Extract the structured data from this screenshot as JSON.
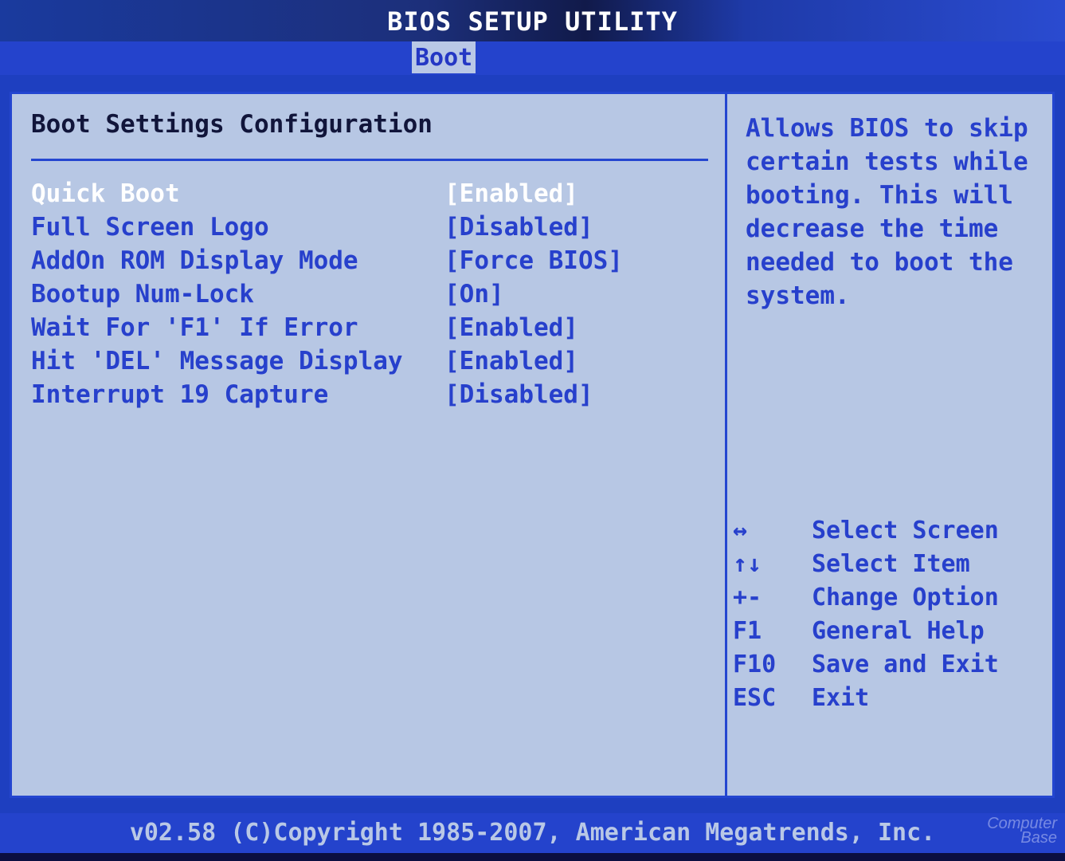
{
  "window": {
    "title": "BIOS SETUP UTILITY"
  },
  "menu": {
    "tabs": [
      {
        "label": "Boot",
        "active": true
      }
    ]
  },
  "main": {
    "section_title": "Boot Settings Configuration",
    "settings": [
      {
        "label": "Quick Boot",
        "value": "[Enabled]",
        "selected": true
      },
      {
        "label": "Full Screen Logo",
        "value": "[Disabled]",
        "selected": false
      },
      {
        "label": "AddOn ROM Display Mode",
        "value": "[Force BIOS]",
        "selected": false
      },
      {
        "label": "Bootup Num-Lock",
        "value": "[On]",
        "selected": false
      },
      {
        "label": "Wait For 'F1' If Error",
        "value": "[Enabled]",
        "selected": false
      },
      {
        "label": "Hit 'DEL' Message Display",
        "value": "[Enabled]",
        "selected": false
      },
      {
        "label": "Interrupt 19 Capture",
        "value": "[Disabled]",
        "selected": false
      }
    ]
  },
  "help": {
    "lines": [
      "Allows BIOS to skip",
      "certain tests while",
      "booting. This will",
      "decrease the time",
      "needed to boot the",
      "system."
    ]
  },
  "keys": [
    {
      "key": "↔",
      "action": "Select Screen"
    },
    {
      "key": "↑↓",
      "action": "Select Item"
    },
    {
      "key": "+-",
      "action": "Change Option"
    },
    {
      "key": "F1",
      "action": "General Help"
    },
    {
      "key": "F10",
      "action": "Save and Exit"
    },
    {
      "key": "ESC",
      "action": "Exit"
    }
  ],
  "footer": {
    "text": "v02.58 (C)Copyright 1985-2007, American Megatrends, Inc."
  },
  "watermark": {
    "line1": "Computer",
    "line2": "Base"
  },
  "colors": {
    "background_blue": "#1e3fc0",
    "panel_gray_blue": "#b7c7e4",
    "text_blue": "#2740cc",
    "selected_text": "#ffffff",
    "title_text": "#11153a"
  }
}
